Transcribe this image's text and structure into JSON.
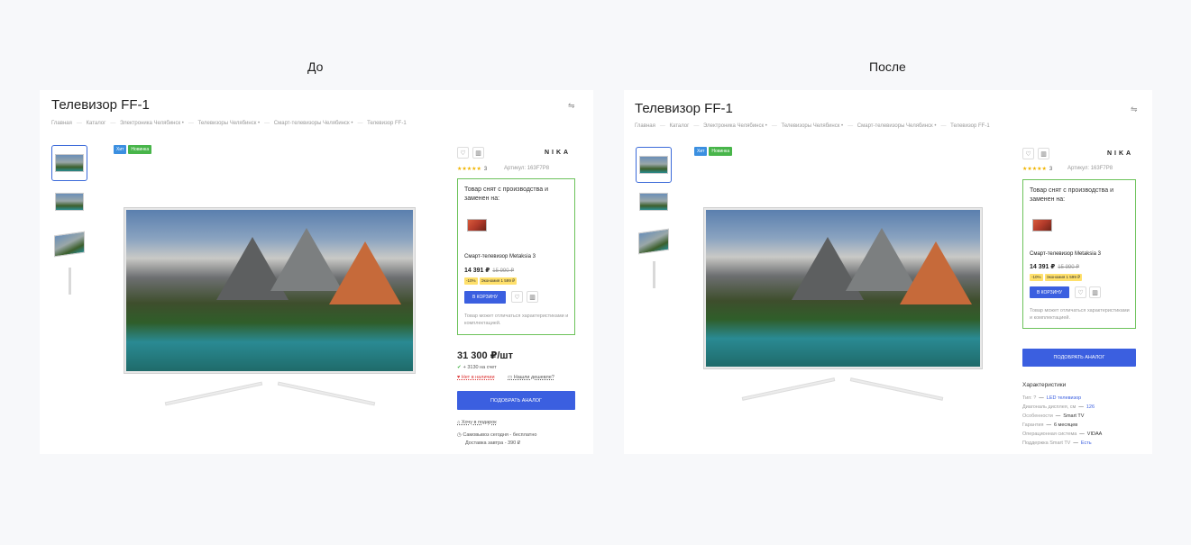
{
  "captions": {
    "before": "До",
    "after": "После"
  },
  "product": {
    "title": "Телевизор FF-1",
    "breadcrumbs": [
      "Главная",
      "Каталог",
      "Электроника Челябинск •",
      "Телевизоры Челябинск •",
      "Смарт-телевизоры Челябинск •",
      "Телевизор FF-1"
    ],
    "badges": {
      "hit": "Хит",
      "new": "Новинка"
    },
    "brand": "NIKA",
    "rating_stars": "★★★★★",
    "rating_count": "3",
    "article": "Артикул: 163F7P8",
    "share_icon": "share-icon"
  },
  "replacement": {
    "heading": "Товар снят с производства и заменен на:",
    "name": "Смарт-телевизор Metaksia 3",
    "price": "14 391 ₽",
    "old_price": "15 990 ₽",
    "discount": "-10%",
    "saving": "Экономия 1 599 ₽",
    "cart_button": "В КОРЗИНУ",
    "note": "Товар может отличаться характеристиками и комплектацией."
  },
  "before": {
    "price": "31 300 ₽/шт",
    "bonus": "+ 3130 на счет",
    "stock": "Нет в наличии",
    "cheaper": "Нашли дешевле?",
    "analog_button": "ПОДОБРАТЬ АНАЛОГ",
    "gift": "Хочу в подарок",
    "delivery_line1": "Самовывоз сегодня - бесплатно",
    "delivery_line2": "Доставка завтра - 390 ₽"
  },
  "after": {
    "analog_button": "ПОДОБРАТЬ АНАЛОГ",
    "specs_title": "Характеристики",
    "specs": [
      {
        "label": "Тип: ?",
        "value": "LED телевизор",
        "link": true
      },
      {
        "label": "Диагональ дисплея, см",
        "value": "126",
        "link": true
      },
      {
        "label": "Особенности",
        "value": "Smart TV",
        "link": false
      },
      {
        "label": "Гарантия",
        "value": "6 месяцев",
        "link": false
      },
      {
        "label": "Операционная система",
        "value": "VIDAA",
        "link": false
      },
      {
        "label": "Поддержка Smart TV",
        "value": "Есть",
        "link": true
      }
    ]
  },
  "colors": {
    "accent_blue": "#3b5fe0",
    "green_border": "#6cc25a",
    "star": "#f0b400",
    "out_of_stock": "#d33"
  }
}
